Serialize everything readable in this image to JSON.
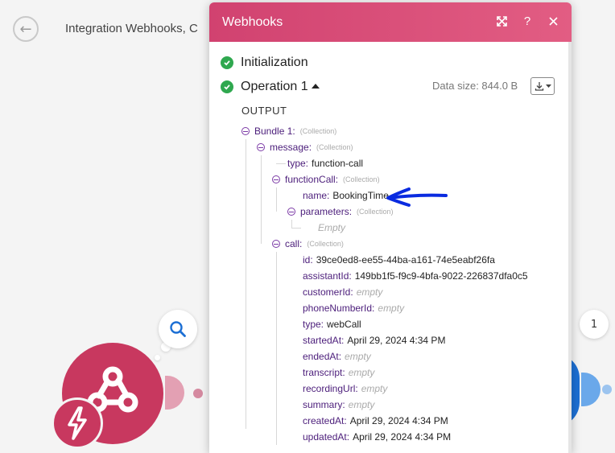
{
  "scenario": {
    "title": "Integration Webhooks, C",
    "right_count": "1"
  },
  "dialog": {
    "title": "Webhooks",
    "sections": {
      "initialization": "Initialization",
      "operation": "Operation 1"
    },
    "data_size": "Data size: 844.0 B",
    "output_label": "OUTPUT",
    "tree": [
      {
        "key": "Bundle 1:",
        "type": "(Collection)"
      },
      {
        "key": "message:",
        "type": "(Collection)"
      },
      {
        "key": "type:",
        "value": "function-call"
      },
      {
        "key": "functionCall:",
        "type": "(Collection)"
      },
      {
        "key": "name:",
        "value": "BookingTime"
      },
      {
        "key": "parameters:",
        "type": "(Collection)"
      },
      {
        "empty": "Empty"
      },
      {
        "key": "call:",
        "type": "(Collection)"
      },
      {
        "key": "id:",
        "value": "39ce0ed8-ee55-44ba-a161-74e5eabf26fa"
      },
      {
        "key": "assistantId:",
        "value": "149bb1f5-f9c9-4bfa-9022-226837dfa0c5"
      },
      {
        "key": "customerId:",
        "empty": "empty"
      },
      {
        "key": "phoneNumberId:",
        "empty": "empty"
      },
      {
        "key": "type:",
        "value": "webCall"
      },
      {
        "key": "startedAt:",
        "value": "April 29, 2024 4:34 PM"
      },
      {
        "key": "endedAt:",
        "empty": "empty"
      },
      {
        "key": "transcript:",
        "empty": "empty"
      },
      {
        "key": "recordingUrl:",
        "empty": "empty"
      },
      {
        "key": "summary:",
        "empty": "empty"
      },
      {
        "key": "createdAt:",
        "value": "April 29, 2024 4:34 PM"
      },
      {
        "key": "updatedAt:",
        "value": "April 29, 2024 4:34 PM"
      }
    ]
  },
  "colors": {
    "header_start": "#d14270",
    "header_end": "#e25d83",
    "success": "#2fa84f",
    "key_text": "#4b1d7a",
    "annotation": "#0a2be0",
    "webhook_module": "#c8385f"
  },
  "icons": {
    "back": "back-arrow-icon",
    "search": "search-icon",
    "maximize": "maximize-icon",
    "help": "help-icon",
    "close": "close-icon",
    "download": "download-icon",
    "webhook": "webhook-icon",
    "instant": "lightning-icon"
  }
}
